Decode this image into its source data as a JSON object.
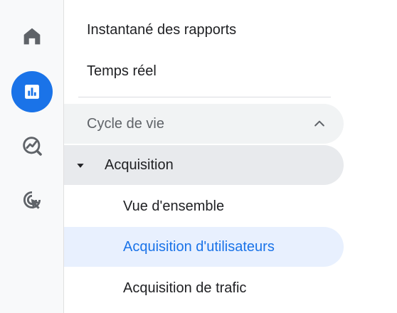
{
  "rail": {
    "items": [
      {
        "icon": "home-icon",
        "active": false
      },
      {
        "icon": "reports-icon",
        "active": true
      },
      {
        "icon": "explore-icon",
        "active": false
      },
      {
        "icon": "advertising-icon",
        "active": false
      }
    ]
  },
  "nav": {
    "top_links": [
      {
        "label": "Instantané des rapports"
      },
      {
        "label": "Temps réel"
      }
    ],
    "section": {
      "label": "Cycle de vie",
      "expanded": true
    },
    "group": {
      "label": "Acquisition",
      "expanded": true,
      "items": [
        {
          "label": "Vue d'ensemble",
          "selected": false
        },
        {
          "label": "Acquisition d'utilisateurs",
          "selected": true
        },
        {
          "label": "Acquisition de trafic",
          "selected": false
        }
      ]
    }
  },
  "colors": {
    "accent": "#1a73e8",
    "selected_bg": "#e8f0fe",
    "icon_gray": "#5f6368"
  }
}
